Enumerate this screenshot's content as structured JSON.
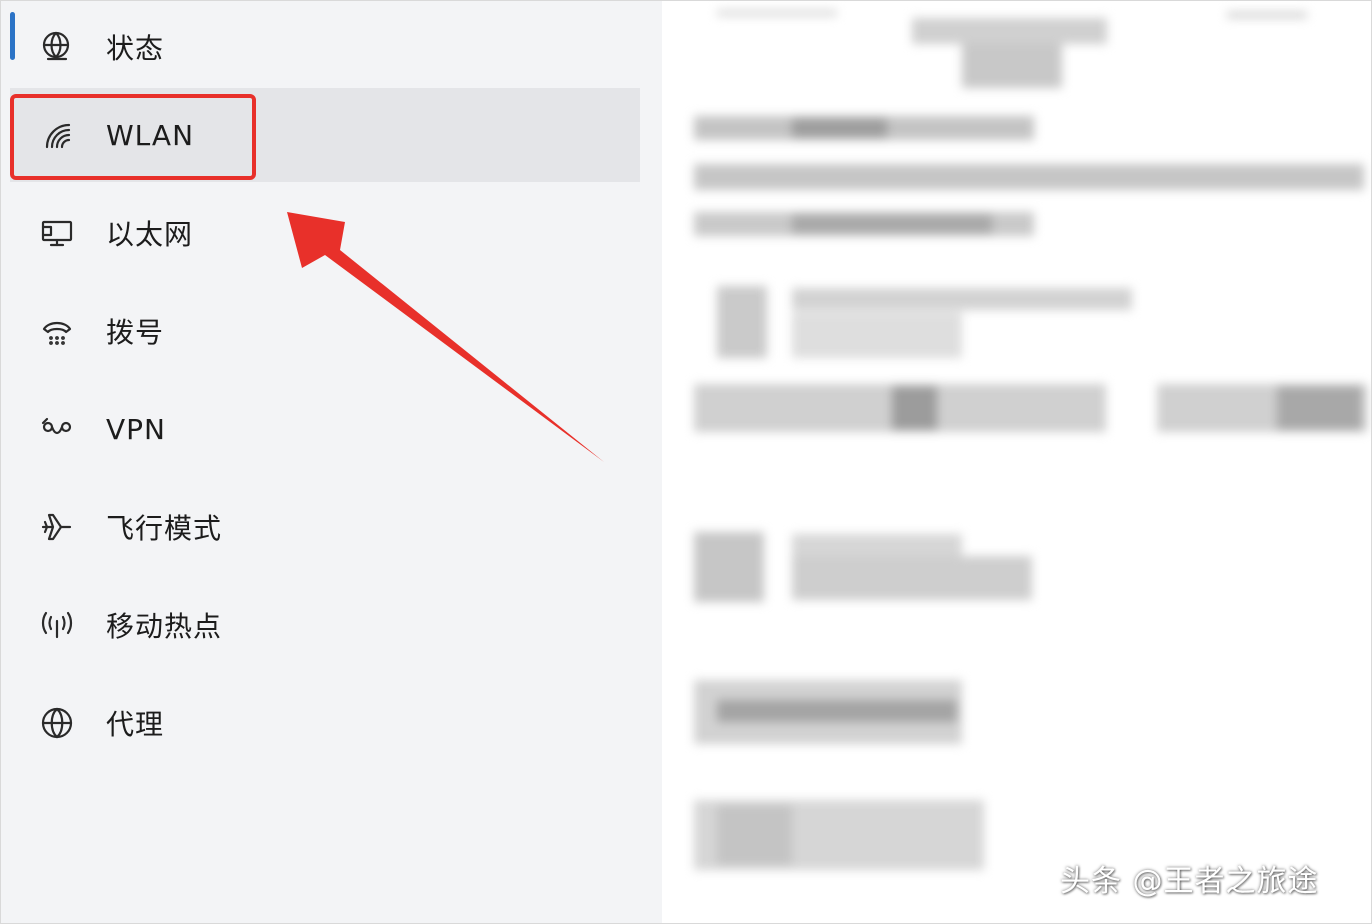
{
  "sidebar": {
    "items": [
      {
        "label": "状态",
        "icon": "globe-status-icon"
      },
      {
        "label": "WLAN",
        "icon": "wifi-icon"
      },
      {
        "label": "以太网",
        "icon": "ethernet-icon"
      },
      {
        "label": "拨号",
        "icon": "dialup-icon"
      },
      {
        "label": "VPN",
        "icon": "vpn-icon"
      },
      {
        "label": "飞行模式",
        "icon": "airplane-icon"
      },
      {
        "label": "移动热点",
        "icon": "hotspot-icon"
      },
      {
        "label": "代理",
        "icon": "globe-icon"
      }
    ],
    "selected_index": 1,
    "accent_color": "#2b73c6"
  },
  "annotation": {
    "highlight_color": "#e8302a"
  },
  "watermark": {
    "text": "头条 @王者之旅途"
  }
}
